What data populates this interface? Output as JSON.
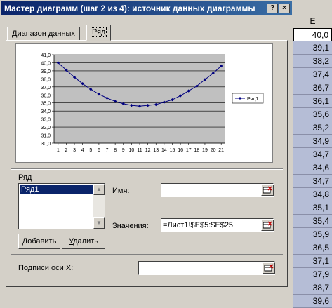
{
  "window": {
    "title": "Мастер диаграмм (шаг 2 из 4): источник данных диаграммы",
    "help": "?",
    "close": "×"
  },
  "tabs": [
    {
      "label": "Диапазон данных"
    },
    {
      "label": "Ряд"
    }
  ],
  "series_section": {
    "label": "Ряд",
    "items": [
      "Ряд1"
    ],
    "add_button": "Добавить",
    "remove_button": "Удалить"
  },
  "fields": {
    "name": {
      "label": "Имя:",
      "value": ""
    },
    "values": {
      "label": "Значения:",
      "value": "=Лист1!$E$5:$E$25"
    },
    "x_labels": {
      "label": "Подписи оси X:",
      "value": ""
    }
  },
  "sheet": {
    "column": "E",
    "values": [
      "40,0",
      "39,1",
      "38,2",
      "37,4",
      "36,7",
      "36,1",
      "35,6",
      "35,2",
      "34,9",
      "34,7",
      "34,6",
      "34,7",
      "34,8",
      "35,1",
      "35,4",
      "35,9",
      "36,5",
      "37,1",
      "37,9",
      "38,7",
      "39,6"
    ]
  },
  "chart_data": {
    "type": "line",
    "x": [
      1,
      2,
      3,
      4,
      5,
      6,
      7,
      8,
      9,
      10,
      11,
      12,
      13,
      14,
      15,
      16,
      17,
      18,
      19,
      20,
      21
    ],
    "series": [
      {
        "name": "Ряд1",
        "values": [
          40.0,
          39.1,
          38.2,
          37.4,
          36.7,
          36.1,
          35.6,
          35.2,
          34.9,
          34.7,
          34.6,
          34.7,
          34.8,
          35.1,
          35.4,
          35.9,
          36.5,
          37.1,
          37.9,
          38.7,
          39.6
        ]
      }
    ],
    "yticks": [
      "41,0",
      "40,0",
      "39,0",
      "38,0",
      "37,0",
      "36,0",
      "35,0",
      "34,0",
      "33,0",
      "32,0",
      "31,0",
      "30,0"
    ],
    "ylim": [
      30,
      41
    ],
    "grid": true,
    "legend": "right",
    "colors": {
      "line": "#000080",
      "plot_bg": "#c0c0c0"
    }
  }
}
